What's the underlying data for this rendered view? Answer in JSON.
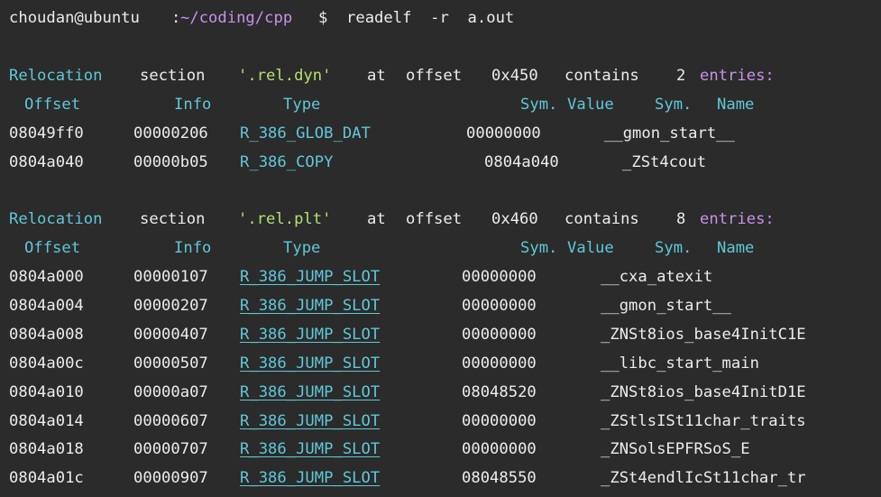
{
  "prompt": {
    "user_host": "choudan@ubuntu",
    "separator": ":",
    "path": "~/coding/cpp",
    "symbol": "$",
    "command": "readelf  -r  a.out"
  },
  "sections": [
    {
      "header": {
        "word_relocation": "Relocation",
        "word_section": "section",
        "name": "'.rel.dyn'",
        "word_at": "at",
        "word_offset": "offset",
        "offset": "0x450",
        "word_contains": "contains",
        "count": "2",
        "word_entries": "entries:"
      },
      "columns": {
        "offset": "Offset",
        "info": "Info",
        "type": "Type",
        "symvalue_a": "Sym.",
        "symvalue_b": "Value",
        "symname_a": "Sym.",
        "symname_b": "Name"
      },
      "rows": [
        {
          "offset": "08049ff0",
          "info": "00000206",
          "type": "R_386_GLOB_DAT",
          "value": "00000000",
          "name": "__gmon_start__"
        },
        {
          "offset": "0804a040",
          "info": "00000b05",
          "type": "R_386_COPY",
          "value": "0804a040",
          "name": "_ZSt4cout"
        }
      ]
    },
    {
      "header": {
        "word_relocation": "Relocation",
        "word_section": "section",
        "name": "'.rel.plt'",
        "word_at": "at",
        "word_offset": "offset",
        "offset": "0x460",
        "word_contains": "contains",
        "count": "8",
        "word_entries": "entries:"
      },
      "columns": {
        "offset": "Offset",
        "info": "Info",
        "type": "Type",
        "symvalue_a": "Sym.",
        "symvalue_b": "Value",
        "symname_a": "Sym.",
        "symname_b": "Name"
      },
      "rows": [
        {
          "offset": "0804a000",
          "info": "00000107",
          "type": "R_386_JUMP_SLOT",
          "value": "00000000",
          "name": "__cxa_atexit"
        },
        {
          "offset": "0804a004",
          "info": "00000207",
          "type": "R_386_JUMP_SLOT",
          "value": "00000000",
          "name": "__gmon_start__"
        },
        {
          "offset": "0804a008",
          "info": "00000407",
          "type": "R_386_JUMP_SLOT",
          "value": "00000000",
          "name": "_ZNSt8ios_base4InitC1E"
        },
        {
          "offset": "0804a00c",
          "info": "00000507",
          "type": "R_386_JUMP_SLOT",
          "value": "00000000",
          "name": "__libc_start_main"
        },
        {
          "offset": "0804a010",
          "info": "00000a07",
          "type": "R_386_JUMP_SLOT",
          "value": "08048520",
          "name": "_ZNSt8ios_base4InitD1E"
        },
        {
          "offset": "0804a014",
          "info": "00000607",
          "type": "R_386_JUMP_SLOT",
          "value": "00000000",
          "name": "_ZStlsISt11char_traits"
        },
        {
          "offset": "0804a018",
          "info": "00000707",
          "type": "R_386_JUMP_SLOT",
          "value": "00000000",
          "name": "_ZNSolsEPFRSoS_E"
        },
        {
          "offset": "0804a01c",
          "info": "00000907",
          "type": "R_386_JUMP_SLOT",
          "value": "08048550",
          "name": "_ZSt4endlIcSt11char_tr"
        }
      ]
    }
  ]
}
